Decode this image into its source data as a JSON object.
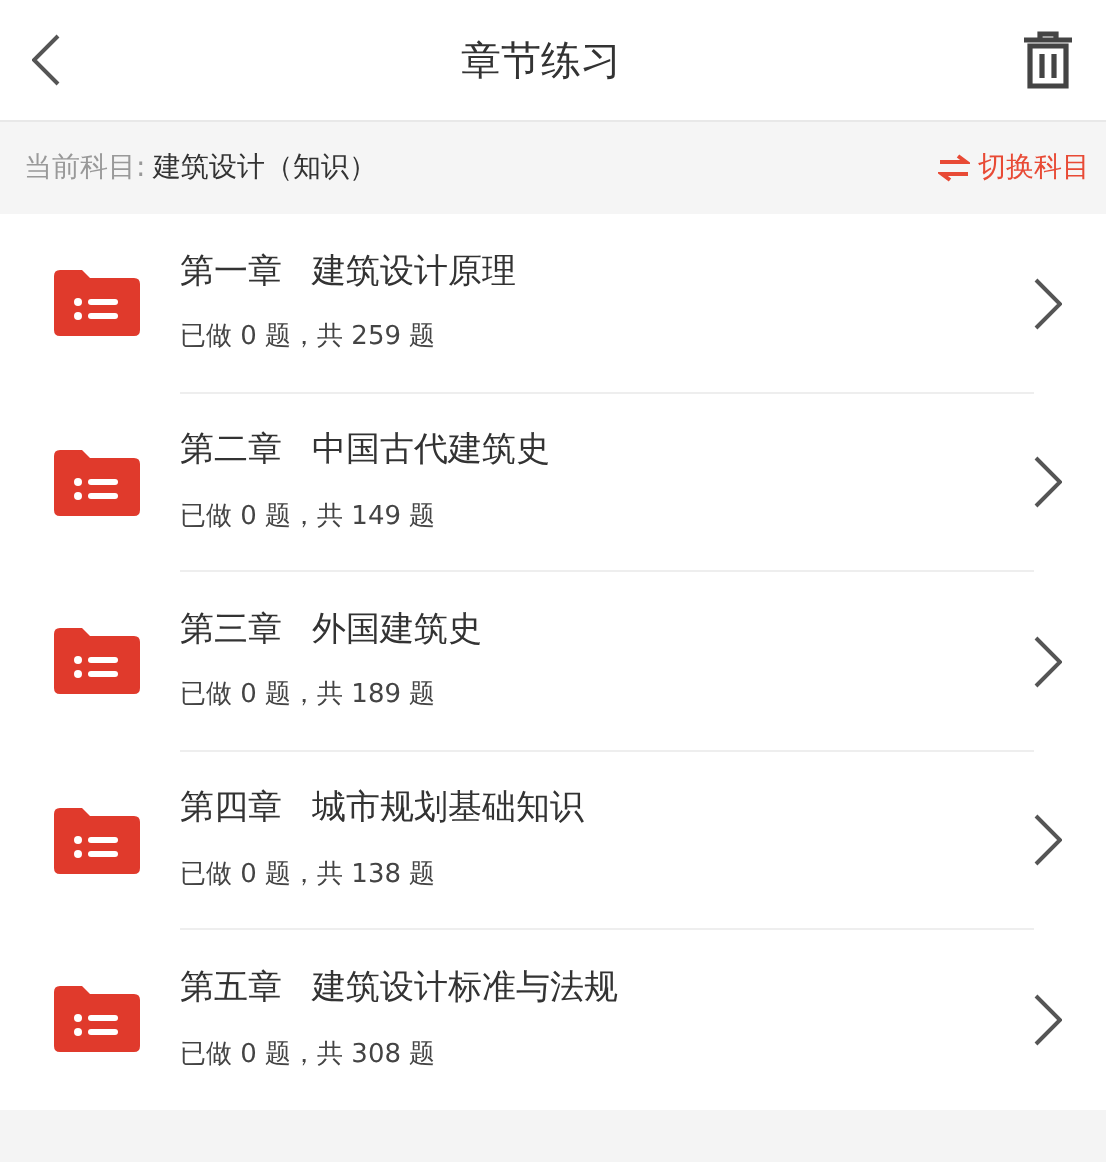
{
  "header": {
    "title": "章节练习"
  },
  "subject_bar": {
    "label": "当前科目:",
    "subject": "建筑设计（知识）",
    "switch_label": "切换科目"
  },
  "chapters": [
    {
      "chapter": "第一章",
      "title": "建筑设计原理",
      "progress": "已做 0 题，共 259 题"
    },
    {
      "chapter": "第二章",
      "title": "中国古代建筑史",
      "progress": "已做 0 题，共 149 题"
    },
    {
      "chapter": "第三章",
      "title": "外国建筑史",
      "progress": "已做 0 题，共 189 题"
    },
    {
      "chapter": "第四章",
      "title": "城市规划基础知识",
      "progress": "已做 0 题，共 138 题"
    },
    {
      "chapter": "第五章",
      "title": "建筑设计标准与法规",
      "progress": "已做 0 题，共 308 题"
    }
  ]
}
